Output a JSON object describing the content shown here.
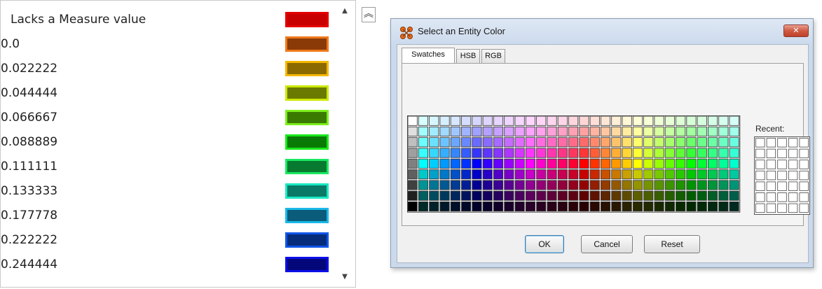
{
  "legend": {
    "items": [
      {
        "label": "Lacks a Measure value",
        "outer": "#e30000",
        "inner": "#c80000"
      },
      {
        "label": "0.0",
        "outer": "#ee7a1c",
        "inner": "#8a3a06"
      },
      {
        "label": "0.022222",
        "outer": "#f5b700",
        "inner": "#8a6a00"
      },
      {
        "label": "0.044444",
        "outer": "#cde800",
        "inner": "#6a7a00"
      },
      {
        "label": "0.066667",
        "outer": "#7cee1c",
        "inner": "#3a7a00"
      },
      {
        "label": "0.088889",
        "outer": "#19e81c",
        "inner": "#0a7a06"
      },
      {
        "label": "0.111111",
        "outer": "#19e860",
        "inner": "#077a30"
      },
      {
        "label": "0.133333",
        "outer": "#19e8c2",
        "inner": "#0a7a66"
      },
      {
        "label": "0.177778",
        "outer": "#1ab8e8",
        "inner": "#0a5c7a"
      },
      {
        "label": "0.222222",
        "outer": "#1055e8",
        "inner": "#062c7a"
      },
      {
        "label": "0.244444",
        "outer": "#0c0fe8",
        "inner": "#04077a"
      }
    ],
    "scroll_up": "▲",
    "scroll_down": "▼",
    "collapse_icon": "collapse-up-icon",
    "collapse_glyph": "︽"
  },
  "dialog": {
    "title": "Select an Entity Color",
    "close_glyph": "✕",
    "tabs": [
      {
        "label": "Swatches",
        "active": true
      },
      {
        "label": "HSB",
        "active": false
      },
      {
        "label": "RGB",
        "active": false
      }
    ],
    "recent_label": "Recent:",
    "buttons": {
      "ok": "OK",
      "cancel": "Cancel",
      "reset": "Reset"
    }
  }
}
